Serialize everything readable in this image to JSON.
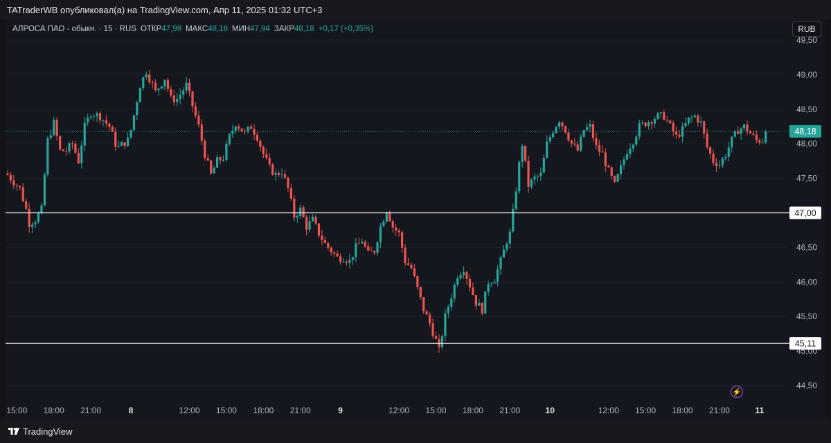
{
  "header": {
    "publisher_text": "TATraderWB опубликовал(а) на TradingView.com, Апр 11, 2025 01:32 UTC+3"
  },
  "legend": {
    "symbol": "АЛРОСА ПАО - обыкн. · 15 · RUS",
    "open_label": "ОТКР",
    "open_value": "47,99",
    "high_label": "МАКС",
    "high_value": "48,18",
    "low_label": "МИН",
    "low_value": "47,94",
    "close_label": "ЗАКР",
    "close_value": "48,18",
    "change": "+0,17 (+0,35%)"
  },
  "currency_button": "RUB",
  "footer": {
    "brand": "TradingView"
  },
  "colors": {
    "up": "#26a69a",
    "down": "#ef5350",
    "background": "#15171e",
    "grid": "#1e2029",
    "axis_text": "#b2b5be",
    "level_line": "#ffffff"
  },
  "icons": {
    "alert": "lightning-icon"
  },
  "chart_data": {
    "type": "candlestick",
    "title": "",
    "ylim": [
      44.3,
      49.5
    ],
    "y_ticks": [
      "44,50",
      "45,00",
      "45,50",
      "46,00",
      "46,50",
      "47,00",
      "47,50",
      "48,00",
      "48,50",
      "49,00",
      "49,50"
    ],
    "x_ticks": [
      {
        "label": "15:00",
        "index": 3,
        "bold": false
      },
      {
        "label": "18:00",
        "index": 15,
        "bold": false
      },
      {
        "label": "21:00",
        "index": 27,
        "bold": false
      },
      {
        "label": "8",
        "index": 40,
        "bold": true
      },
      {
        "label": "12:00",
        "index": 59,
        "bold": false
      },
      {
        "label": "15:00",
        "index": 71,
        "bold": false
      },
      {
        "label": "18:00",
        "index": 83,
        "bold": false
      },
      {
        "label": "21:00",
        "index": 95,
        "bold": false
      },
      {
        "label": "9",
        "index": 108,
        "bold": true
      },
      {
        "label": "12:00",
        "index": 127,
        "bold": false
      },
      {
        "label": "15:00",
        "index": 139,
        "bold": false
      },
      {
        "label": "18:00",
        "index": 151,
        "bold": false
      },
      {
        "label": "21:00",
        "index": 163,
        "bold": false
      },
      {
        "label": "10",
        "index": 176,
        "bold": true
      },
      {
        "label": "12:00",
        "index": 195,
        "bold": false
      },
      {
        "label": "15:00",
        "index": 207,
        "bold": false
      },
      {
        "label": "18:00",
        "index": 219,
        "bold": false
      },
      {
        "label": "21:00",
        "index": 231,
        "bold": false
      },
      {
        "label": "11",
        "index": 244,
        "bold": true
      }
    ],
    "horizontal_levels": [
      {
        "value": 47.0,
        "label": "47,00"
      },
      {
        "value": 45.11,
        "label": "45,11"
      }
    ],
    "last_price": {
      "value": 48.18,
      "label": "48,18"
    },
    "close_path": [
      [
        0,
        47.55
      ],
      [
        4,
        47.35
      ],
      [
        6,
        47.05
      ],
      [
        7,
        46.85
      ],
      [
        9,
        46.9
      ],
      [
        11,
        47.05
      ],
      [
        13,
        48.05
      ],
      [
        15,
        48.3
      ],
      [
        17,
        47.9
      ],
      [
        19,
        47.9
      ],
      [
        21,
        48.0
      ],
      [
        23,
        47.75
      ],
      [
        25,
        48.25
      ],
      [
        27,
        48.45
      ],
      [
        30,
        48.4
      ],
      [
        33,
        48.25
      ],
      [
        35,
        48.0
      ],
      [
        36,
        47.95
      ],
      [
        39,
        48.05
      ],
      [
        40,
        48.2
      ],
      [
        43,
        48.85
      ],
      [
        45,
        49.05
      ],
      [
        48,
        48.75
      ],
      [
        51,
        48.95
      ],
      [
        53,
        48.65
      ],
      [
        55,
        48.65
      ],
      [
        58,
        48.85
      ],
      [
        60,
        48.55
      ],
      [
        62,
        48.25
      ],
      [
        64,
        47.85
      ],
      [
        66,
        47.55
      ],
      [
        68,
        47.75
      ],
      [
        70,
        47.8
      ],
      [
        72,
        48.1
      ],
      [
        74,
        48.3
      ],
      [
        77,
        48.15
      ],
      [
        79,
        48.25
      ],
      [
        81,
        48.1
      ],
      [
        83,
        47.85
      ],
      [
        85,
        47.65
      ],
      [
        87,
        47.55
      ],
      [
        89,
        47.6
      ],
      [
        91,
        47.35
      ],
      [
        93,
        46.95
      ],
      [
        95,
        47.05
      ],
      [
        97,
        46.8
      ],
      [
        99,
        46.9
      ],
      [
        101,
        46.7
      ],
      [
        103,
        46.55
      ],
      [
        105,
        46.45
      ],
      [
        107,
        46.35
      ],
      [
        109,
        46.35
      ],
      [
        111,
        46.3
      ],
      [
        113,
        46.5
      ],
      [
        115,
        46.6
      ],
      [
        117,
        46.4
      ],
      [
        119,
        46.45
      ],
      [
        121,
        46.8
      ],
      [
        123,
        47.05
      ],
      [
        125,
        46.8
      ],
      [
        127,
        46.7
      ],
      [
        129,
        46.3
      ],
      [
        131,
        46.2
      ],
      [
        133,
        45.9
      ],
      [
        135,
        45.6
      ],
      [
        137,
        45.4
      ],
      [
        139,
        45.15
      ],
      [
        140,
        45.0
      ],
      [
        142,
        45.5
      ],
      [
        144,
        45.8
      ],
      [
        146,
        46.1
      ],
      [
        148,
        46.2
      ],
      [
        150,
        45.95
      ],
      [
        152,
        45.7
      ],
      [
        154,
        45.6
      ],
      [
        156,
        46.0
      ],
      [
        158,
        46.05
      ],
      [
        160,
        46.3
      ],
      [
        162,
        46.6
      ],
      [
        163,
        46.7
      ],
      [
        164,
        47.0
      ],
      [
        166,
        47.7
      ],
      [
        167,
        48.0
      ],
      [
        169,
        47.4
      ],
      [
        171,
        47.5
      ],
      [
        173,
        47.55
      ],
      [
        175,
        48.0
      ],
      [
        177,
        48.2
      ],
      [
        179,
        48.35
      ],
      [
        181,
        48.2
      ],
      [
        183,
        48.0
      ],
      [
        185,
        47.9
      ],
      [
        187,
        48.2
      ],
      [
        189,
        48.25
      ],
      [
        191,
        47.95
      ],
      [
        193,
        47.85
      ],
      [
        195,
        47.6
      ],
      [
        197,
        47.4
      ],
      [
        199,
        47.65
      ],
      [
        201,
        47.9
      ],
      [
        203,
        48.05
      ],
      [
        205,
        48.25
      ],
      [
        207,
        48.3
      ],
      [
        209,
        48.35
      ],
      [
        211,
        48.4
      ],
      [
        213,
        48.4
      ],
      [
        215,
        48.25
      ],
      [
        217,
        48.1
      ],
      [
        219,
        48.2
      ],
      [
        221,
        48.35
      ],
      [
        223,
        48.4
      ],
      [
        225,
        48.3
      ],
      [
        227,
        47.95
      ],
      [
        229,
        47.75
      ],
      [
        231,
        47.7
      ],
      [
        233,
        47.85
      ],
      [
        235,
        48.05
      ],
      [
        237,
        48.2
      ],
      [
        239,
        48.25
      ],
      [
        241,
        48.15
      ],
      [
        243,
        48.05
      ],
      [
        245,
        48.05
      ],
      [
        246,
        48.18
      ]
    ]
  }
}
